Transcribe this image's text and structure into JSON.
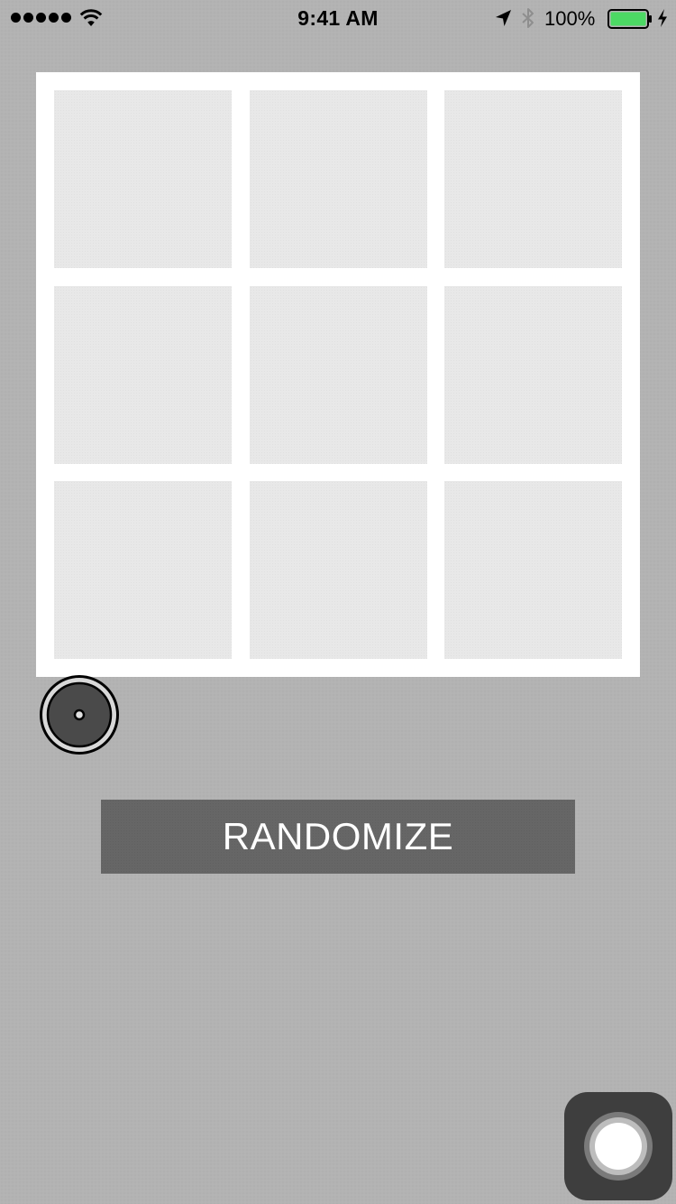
{
  "status_bar": {
    "signal_dots": 5,
    "wifi_icon": "wifi-icon",
    "time": "9:41 AM",
    "location_icon": "location-arrow-icon",
    "bluetooth_icon": "bluetooth-icon",
    "battery_percent": "100%",
    "battery_level": 1.0,
    "battery_color": "#4cd964",
    "charging_icon": "charging-bolt-icon"
  },
  "board": {
    "rows": 3,
    "columns": 3,
    "background_color": "#ffffff",
    "cell_color": "#e8e8e8"
  },
  "touch_indicator": {
    "icon": "touch-point-icon"
  },
  "randomize_button": {
    "label": "RANDOMIZE",
    "background_color": "#666666",
    "text_color": "#ffffff"
  },
  "assistive_touch": {
    "icon": "assistive-touch-icon"
  },
  "colors": {
    "page_background": "#b3b3b3"
  }
}
